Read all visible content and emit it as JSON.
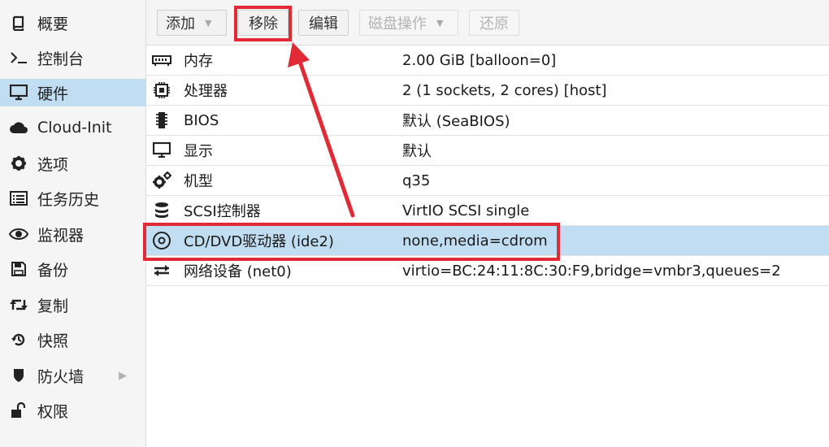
{
  "sidebar": {
    "items": [
      {
        "label": "概要",
        "icon": "book-icon"
      },
      {
        "label": "控制台",
        "icon": "terminal-icon"
      },
      {
        "label": "硬件",
        "icon": "monitor-icon"
      },
      {
        "label": "Cloud-Init",
        "icon": "cloud-icon"
      },
      {
        "label": "选项",
        "icon": "gear-icon"
      },
      {
        "label": "任务历史",
        "icon": "list-icon"
      },
      {
        "label": "监视器",
        "icon": "eye-icon"
      },
      {
        "label": "备份",
        "icon": "floppy-icon"
      },
      {
        "label": "复制",
        "icon": "retweet-icon"
      },
      {
        "label": "快照",
        "icon": "history-icon"
      },
      {
        "label": "防火墙",
        "icon": "shield-icon"
      },
      {
        "label": "权限",
        "icon": "unlock-icon"
      }
    ],
    "selected_index": 2
  },
  "toolbar": {
    "add_label": "添加",
    "remove_label": "移除",
    "edit_label": "编辑",
    "disk_action_label": "磁盘操作",
    "revert_label": "还原"
  },
  "hardware": {
    "rows": [
      {
        "name": "内存",
        "value": "2.00 GiB [balloon=0]",
        "icon": "memory-icon"
      },
      {
        "name": "处理器",
        "value": "2 (1 sockets, 2 cores) [host]",
        "icon": "cpu-icon"
      },
      {
        "name": "BIOS",
        "value": "默认 (SeaBIOS)",
        "icon": "microchip-icon"
      },
      {
        "name": "显示",
        "value": "默认",
        "icon": "monitor-icon"
      },
      {
        "name": "机型",
        "value": "q35",
        "icon": "cogs-icon"
      },
      {
        "name": "SCSI控制器",
        "value": "VirtIO SCSI single",
        "icon": "database-icon"
      },
      {
        "name": "CD/DVD驱动器 (ide2)",
        "value": "none,media=cdrom",
        "icon": "cdrom-icon"
      },
      {
        "name": "网络设备 (net0)",
        "value": "virtio=BC:24:11:8C:30:F9,bridge=vmbr3,queues=2",
        "icon": "exchange-icon"
      }
    ],
    "selected_index": 6
  },
  "colors": {
    "selection": "#c1ddf1",
    "annotation": "#e02a35"
  }
}
